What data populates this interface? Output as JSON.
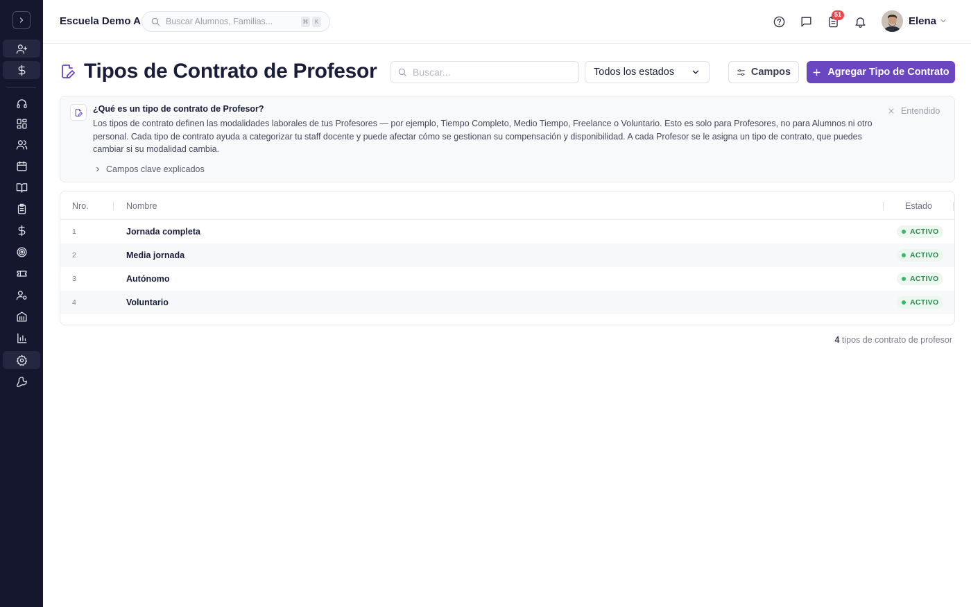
{
  "header": {
    "school_name": "Escuela Demo A",
    "search_placeholder": "Buscar Alumnos, Familias...",
    "shortcut_keys": [
      "⌘",
      "K"
    ],
    "notification_count": "51",
    "user_name": "Elena"
  },
  "sidebar": {
    "items": [
      {
        "icon": "user-plus-icon"
      },
      {
        "icon": "dollar-icon"
      },
      {
        "icon": "headset-icon"
      },
      {
        "icon": "dashboard-icon"
      },
      {
        "icon": "users-icon"
      },
      {
        "icon": "calendar-icon"
      },
      {
        "icon": "book-icon"
      },
      {
        "icon": "clipboard-icon"
      },
      {
        "icon": "dollar-icon"
      },
      {
        "icon": "target-icon"
      },
      {
        "icon": "ticket-icon"
      },
      {
        "icon": "user-settings-icon"
      },
      {
        "icon": "building-icon"
      },
      {
        "icon": "bar-chart-icon"
      },
      {
        "icon": "gear-icon",
        "active": true
      },
      {
        "icon": "wrench-icon"
      }
    ]
  },
  "page": {
    "title": "Tipos de Contrato de Profesor",
    "search_placeholder": "Buscar...",
    "status_filter": "Todos los estados",
    "fields_button": "Campos",
    "add_button": "Agregar Tipo de Contrato"
  },
  "info": {
    "title": "¿Qué es un tipo de contrato de Profesor?",
    "body": "Los tipos de contrato definen las modalidades laborales de tus Profesores — por ejemplo, Tiempo Completo, Medio Tiempo, Freelance o Voluntario. Esto es solo para Profesores, no para Alumnos ni otro personal. Cada tipo de contrato ayuda a categorizar tu staff docente y puede afectar cómo se gestionan su compensación y disponibilidad. A cada Profesor se le asigna un tipo de contrato, que puedes cambiar si su modalidad cambia.",
    "dismiss": "Entendido",
    "key_fields": "Campos clave explicados"
  },
  "table": {
    "columns": [
      "Nro.",
      "Nombre",
      "Estado"
    ],
    "rows": [
      {
        "num": "1",
        "name": "Jornada completa",
        "status": "ACTIVO"
      },
      {
        "num": "2",
        "name": "Media jornada",
        "status": "ACTIVO"
      },
      {
        "num": "3",
        "name": "Autónomo",
        "status": "ACTIVO"
      },
      {
        "num": "4",
        "name": "Voluntario",
        "status": "ACTIVO"
      }
    ]
  },
  "footer": {
    "count": "4",
    "count_label": "tipos de contrato de profesor"
  },
  "colors": {
    "sidebar_bg": "#15172e",
    "primary": "#6b46c1",
    "status_active": "#2d8a4e",
    "badge": "#e5484d"
  }
}
